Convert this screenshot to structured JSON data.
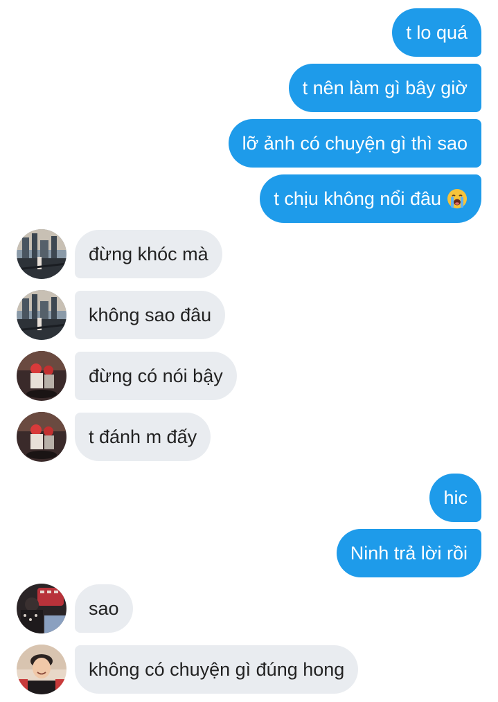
{
  "messages": [
    {
      "side": "out",
      "text": "t lo quá"
    },
    {
      "side": "out",
      "text": "t nên làm gì bây giờ"
    },
    {
      "side": "out",
      "text": "lỡ ảnh có chuyện gì thì sao"
    },
    {
      "side": "out",
      "text": "t chịu không nổi đâu",
      "emoji": "loudly-crying-face-icon"
    },
    {
      "side": "in",
      "text": "đừng khóc mà",
      "avatar": "city-street-photo"
    },
    {
      "side": "in",
      "text": "không sao đâu",
      "avatar": "city-street-photo"
    },
    {
      "side": "in",
      "text": "đừng có nói bậy",
      "avatar": "motorbike-riders-photo"
    },
    {
      "side": "in",
      "text": "t đánh m đấy",
      "avatar": "motorbike-riders-photo"
    },
    {
      "side": "out",
      "text": "hic"
    },
    {
      "side": "out",
      "text": "Ninh trả lời rồi"
    },
    {
      "side": "in",
      "text": "sao",
      "avatar": "red-cap-person-photo"
    },
    {
      "side": "in",
      "text": "không có chuyện gì đúng hong",
      "avatar": "smiling-man-photo"
    }
  ],
  "colors": {
    "outgoing_bubble": "#1e9bea",
    "incoming_bubble": "#e9ecf0",
    "outgoing_text": "#ffffff",
    "incoming_text": "#222222"
  }
}
